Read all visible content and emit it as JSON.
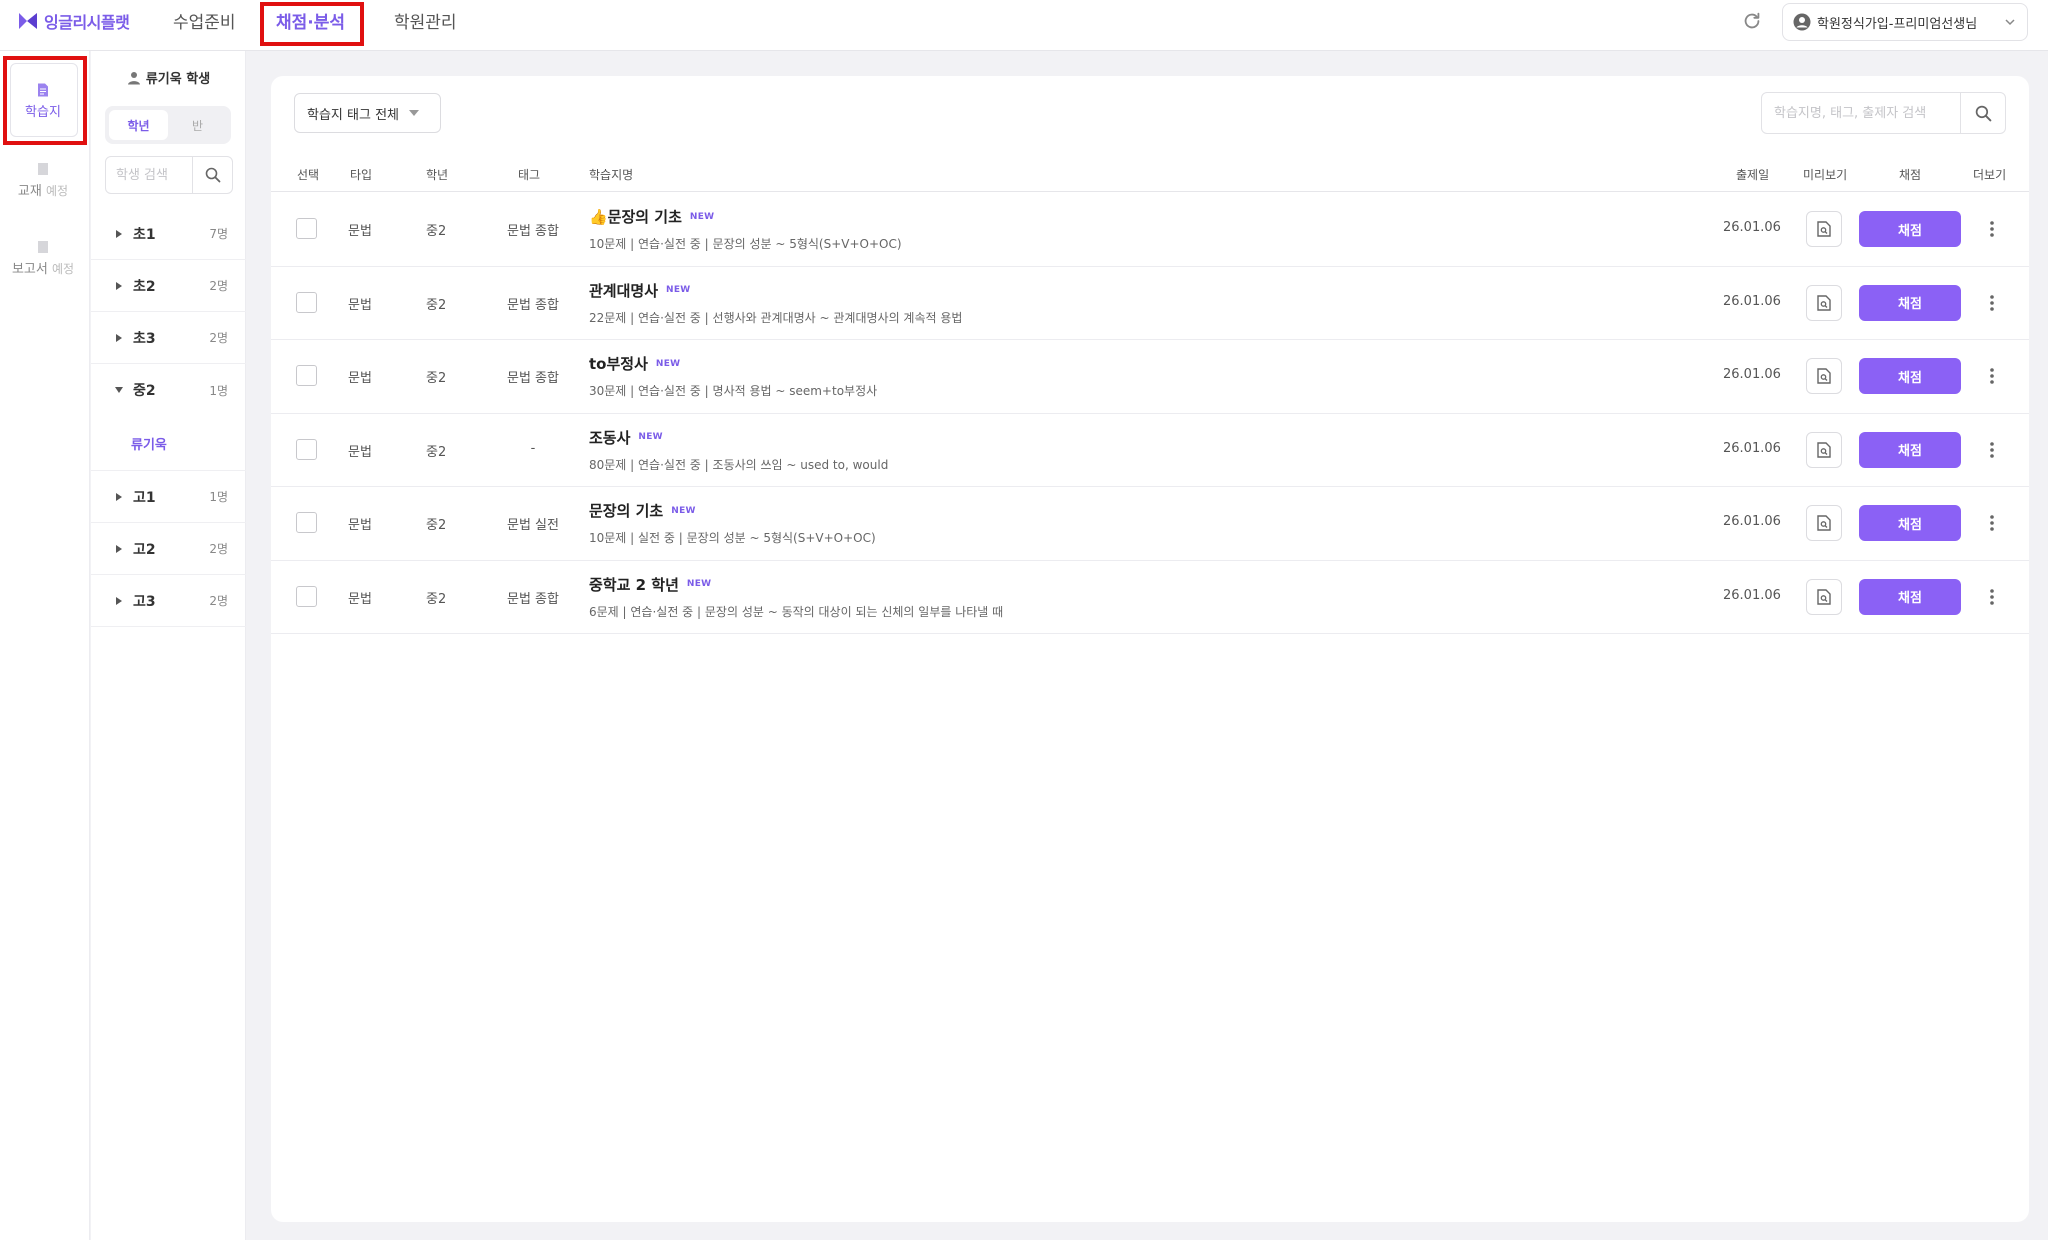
{
  "brand": {
    "name": "잉글리시플랫"
  },
  "nav": [
    {
      "label": "수업준비"
    },
    {
      "label": "채점·분석"
    },
    {
      "label": "학원관리"
    }
  ],
  "user": {
    "name": "학원정식가입-프리미엄선생님"
  },
  "rail": [
    {
      "label": "학습지",
      "badge": ""
    },
    {
      "label": "교재",
      "badge": "예정"
    },
    {
      "label": "보고서",
      "badge": "예정"
    }
  ],
  "students": {
    "title": "류기욱 학생",
    "seg": [
      "학년",
      "반"
    ],
    "search_placeholder": "학생 검색",
    "grades": [
      {
        "name": "초1",
        "count": "7명"
      },
      {
        "name": "초2",
        "count": "2명"
      },
      {
        "name": "초3",
        "count": "2명"
      },
      {
        "name": "중2",
        "count": "1명",
        "student": "류기욱"
      },
      {
        "name": "고1",
        "count": "1명"
      },
      {
        "name": "고2",
        "count": "2명"
      },
      {
        "name": "고3",
        "count": "2명"
      }
    ]
  },
  "filter": {
    "tag_label": "학습지 태그 전체"
  },
  "search": {
    "placeholder": "학습지명, 태그, 출제자 검색"
  },
  "table": {
    "headers": {
      "select": "선택",
      "type": "타입",
      "grade": "학년",
      "tag": "태그",
      "name": "학습지명",
      "date": "출제일",
      "preview": "미리보기",
      "grading": "채점",
      "more": "더보기"
    },
    "new_badge": "NEW",
    "grade_button": "채점",
    "rows": [
      {
        "type": "문법",
        "grade": "중2",
        "tag": "문법 종합",
        "title": "👍문장의 기초",
        "desc": "10문제 | 연습·실전 중 | 문장의 성분 ~ 5형식(S+V+O+OC)",
        "date": "26.01.06"
      },
      {
        "type": "문법",
        "grade": "중2",
        "tag": "문법 종합",
        "title": "관계대명사",
        "desc": "22문제 | 연습·실전 중 | 선행사와 관계대명사 ~ 관계대명사의 계속적 용법",
        "date": "26.01.06"
      },
      {
        "type": "문법",
        "grade": "중2",
        "tag": "문법 종합",
        "title": "to부정사",
        "desc": "30문제 | 연습·실전 중 | 명사적 용법 ~ seem+to부정사",
        "date": "26.01.06"
      },
      {
        "type": "문법",
        "grade": "중2",
        "tag": "-",
        "title": "조동사",
        "desc": "80문제 | 연습·실전 중 | 조동사의 쓰임 ~ used to, would",
        "date": "26.01.06"
      },
      {
        "type": "문법",
        "grade": "중2",
        "tag": "문법 실전",
        "title": "문장의 기초",
        "desc": "10문제 | 실전 중 | 문장의 성분 ~ 5형식(S+V+O+OC)",
        "date": "26.01.06"
      },
      {
        "type": "문법",
        "grade": "중2",
        "tag": "문법 종합",
        "title": "중학교 2 학년",
        "desc": "6문제 | 연습·실전 중 | 문장의 성분 ~ 동작의 대상이 되는 신체의 일부를 나타낼 때",
        "date": "26.01.06"
      }
    ]
  },
  "colors": {
    "accent": "#8b61f5",
    "brand": "#7b5ce8",
    "highlight": "#e01010"
  }
}
